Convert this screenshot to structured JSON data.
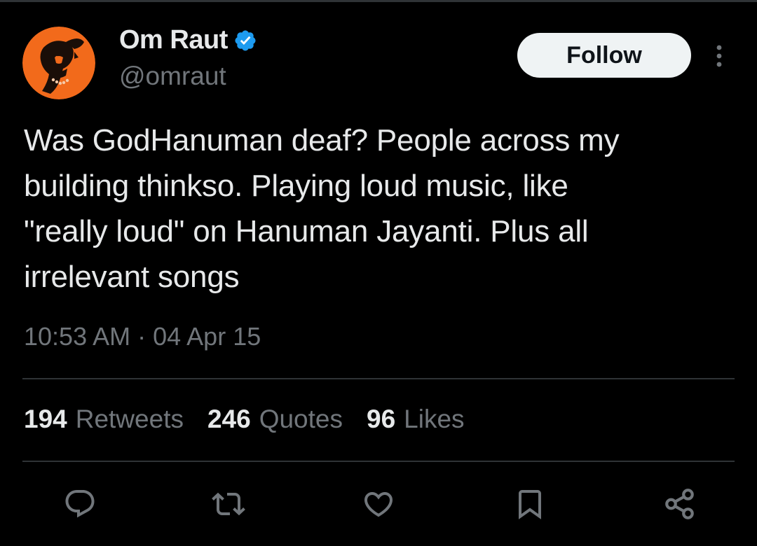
{
  "author": {
    "name": "Om Raut",
    "handle": "@omraut",
    "verified": true,
    "avatar_bg": "#f26a1b"
  },
  "follow_label": "Follow",
  "tweet": {
    "text": "Was GodHanuman deaf? People across my\nbuilding thinkso. Playing loud music, like\n\"really loud\" on Hanuman Jayanti. Plus all\nirrelevant songs",
    "time": "10:53 AM",
    "separator": "·",
    "date": "04 Apr 15"
  },
  "stats": {
    "retweets": {
      "count": "194",
      "label": "Retweets"
    },
    "quotes": {
      "count": "246",
      "label": "Quotes"
    },
    "likes": {
      "count": "96",
      "label": "Likes"
    }
  },
  "actions": [
    {
      "icon": "reply-icon"
    },
    {
      "icon": "retweet-icon"
    },
    {
      "icon": "heart-icon"
    },
    {
      "icon": "bookmark-icon"
    },
    {
      "icon": "share-icon"
    }
  ],
  "colors": {
    "background": "#000000",
    "primary_text": "#e7e9ea",
    "secondary_text": "#71767b",
    "divider": "#2f3336",
    "verified": "#1d9bf0",
    "follow_bg": "#eff3f4"
  }
}
